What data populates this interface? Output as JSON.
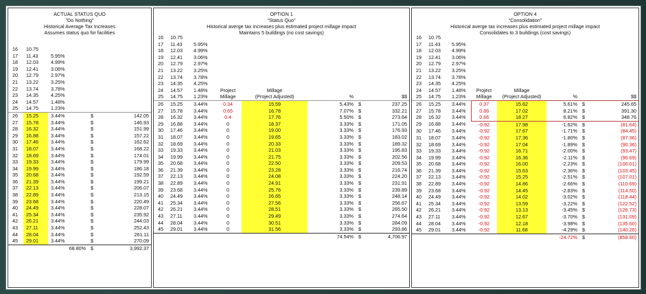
{
  "panels": [
    {
      "title": "ACTUAL STATUS QUO",
      "subtitle": "\"Do Nothing\"",
      "line3": "Historical Average Tax Increases",
      "line4": "Assumes status quo for facilities"
    },
    {
      "title": "OPTION 1",
      "subtitle": "\"Status Quo\"",
      "line3": "Historical averge tax increases plus estimated project millage impact",
      "line4": "Maintains 5 buildings (no cost savings)"
    },
    {
      "title": "OPTION 4",
      "subtitle": "\"Consolidation\"",
      "line3": "Historical averge tax increases plus estimated project millage impact",
      "line4": "Consolidates to 3 buildings (cost savings)"
    }
  ],
  "col_headers": {
    "project": "Project",
    "millage": "Millage",
    "millage2": "Millage",
    "adjusted": "(Project Adjusted)",
    "pct": "%",
    "dollars": "$$"
  },
  "base_rows": [
    {
      "y": "16",
      "v": "10.75",
      "p": ""
    },
    {
      "y": "17",
      "v": "11.43",
      "p": "5.95%"
    },
    {
      "y": "18",
      "v": "12.03",
      "p": "4.99%"
    },
    {
      "y": "19",
      "v": "12.41",
      "p": "3.06%"
    },
    {
      "y": "20",
      "v": "12.79",
      "p": "2.97%"
    },
    {
      "y": "21",
      "v": "13.22",
      "p": "3.25%"
    },
    {
      "y": "22",
      "v": "13.74",
      "p": "3.78%"
    },
    {
      "y": "23",
      "v": "14.35",
      "p": "4.25%"
    },
    {
      "y": "24",
      "v": "14.57",
      "p": "1.48%"
    },
    {
      "y": "25",
      "v": "14.75",
      "p": "1.23%"
    }
  ],
  "proj_years": [
    "26",
    "27",
    "28",
    "29",
    "30",
    "31",
    "32",
    "33",
    "34",
    "35",
    "36",
    "37",
    "38",
    "39",
    "40",
    "41",
    "42",
    "43",
    "44",
    "45"
  ],
  "proj_vals": [
    "15.25",
    "15.78",
    "16.32",
    "16.88",
    "17.46",
    "18.07",
    "18.69",
    "19.33",
    "19.99",
    "20.68",
    "21.39",
    "22.13",
    "22.89",
    "23.68",
    "24.49",
    "25.34",
    "26.21",
    "27.11",
    "28.04",
    "29.01"
  ],
  "proj_pct": "3.44%",
  "sq_dollars": [
    "142.05",
    "146.93",
    "151.99",
    "157.22",
    "162.62",
    "168.22",
    "174.01",
    "179.99",
    "186.18",
    "192.59",
    "199.21",
    "206.07",
    "213.15",
    "220.49",
    "228.07",
    "235.92",
    "244.03",
    "252.43",
    "261.11",
    "270.09"
  ],
  "opt1_mill": [
    "0.34",
    "0.65",
    "0.4",
    "0",
    "0",
    "0",
    "0",
    "0",
    "0",
    "0",
    "0",
    "0",
    "0",
    "0",
    "0",
    "0",
    "0",
    "0",
    "0",
    "0"
  ],
  "opt1_adj": [
    "15.59",
    "16.78",
    "17.76",
    "18.37",
    "19.00",
    "19.65",
    "20.33",
    "21.03",
    "21.75",
    "22.50",
    "23.28",
    "24.08",
    "24.91",
    "25.76",
    "26.65",
    "27.56",
    "28.51",
    "29.49",
    "30.51",
    "31.56"
  ],
  "opt1_pct": [
    "5.43%",
    "7.07%",
    "5.50%",
    "3.33%",
    "3.33%",
    "3.33%",
    "3.33%",
    "3.33%",
    "3.33%",
    "3.33%",
    "3.33%",
    "3.33%",
    "3.33%",
    "3.33%",
    "3.33%",
    "3.33%",
    "3.33%",
    "3.33%",
    "3.33%",
    "3.33%"
  ],
  "opt1_dollars": [
    "237.25",
    "332.21",
    "273.64",
    "171.05",
    "176.93",
    "183.02",
    "189.32",
    "195.83",
    "202.56",
    "209.53",
    "216.74",
    "224.20",
    "231.91",
    "239.89",
    "248.14",
    "256.67",
    "265.50",
    "274.64",
    "284.09",
    "293.86"
  ],
  "opt4_mill": [
    "0.37",
    "0.86",
    "0.66",
    "-0.92",
    "-0.92",
    "-0.92",
    "-0.92",
    "-0.92",
    "-0.92",
    "-0.92",
    "-0.92",
    "-0.92",
    "-0.92",
    "-0.92",
    "-0.92",
    "-0.92",
    "-0.92",
    "-0.92",
    "-0.92",
    "-0.92"
  ],
  "opt4_adj": [
    "15.62",
    "17.02",
    "18.27",
    "17.98",
    "17.67",
    "17.36",
    "17.04",
    "16.71",
    "16.36",
    "16.00",
    "15.63",
    "15.25",
    "14.86",
    "14.45",
    "14.02",
    "13.59",
    "13.13",
    "12.67",
    "12.18",
    "11.68"
  ],
  "opt4_pct": [
    "5.61%",
    "8.21%",
    "6.82%",
    "-1.62%",
    "-1.71%",
    "-1.80%",
    "-1.89%",
    "-2.00%",
    "-2.11%",
    "-2.23%",
    "-2.36%",
    "-2.51%",
    "-2.66%",
    "-2.83%",
    "-3.02%",
    "-3.22%",
    "-3.45%",
    "-3.70%",
    "-3.98%",
    "-4.29%"
  ],
  "opt4_dollars": [
    "245.65",
    "391.30",
    "348.76",
    "(81.64)",
    "(84.45)",
    "(87.36)",
    "(90.36)",
    "(93.47)",
    "(96.69)",
    "(100.01)",
    "(103.45)",
    "(107.01)",
    "(110.69)",
    "(114.50)",
    "(118.44)",
    "(122.52)",
    "(126.73)",
    "(131.09)",
    "(135.60)",
    "(140.26)"
  ],
  "totals": {
    "sq_pct": "68.80%",
    "sq_dollars": "3,992.37",
    "opt1_pct": "74.54%",
    "opt1_dollars": "4,706.97",
    "opt4_pct": "-24.72%",
    "opt4_dollars": "(858.60)"
  },
  "dollar_sign": "$",
  "colors": {
    "highlight": "#ffff33",
    "negative": "#dd1111"
  }
}
